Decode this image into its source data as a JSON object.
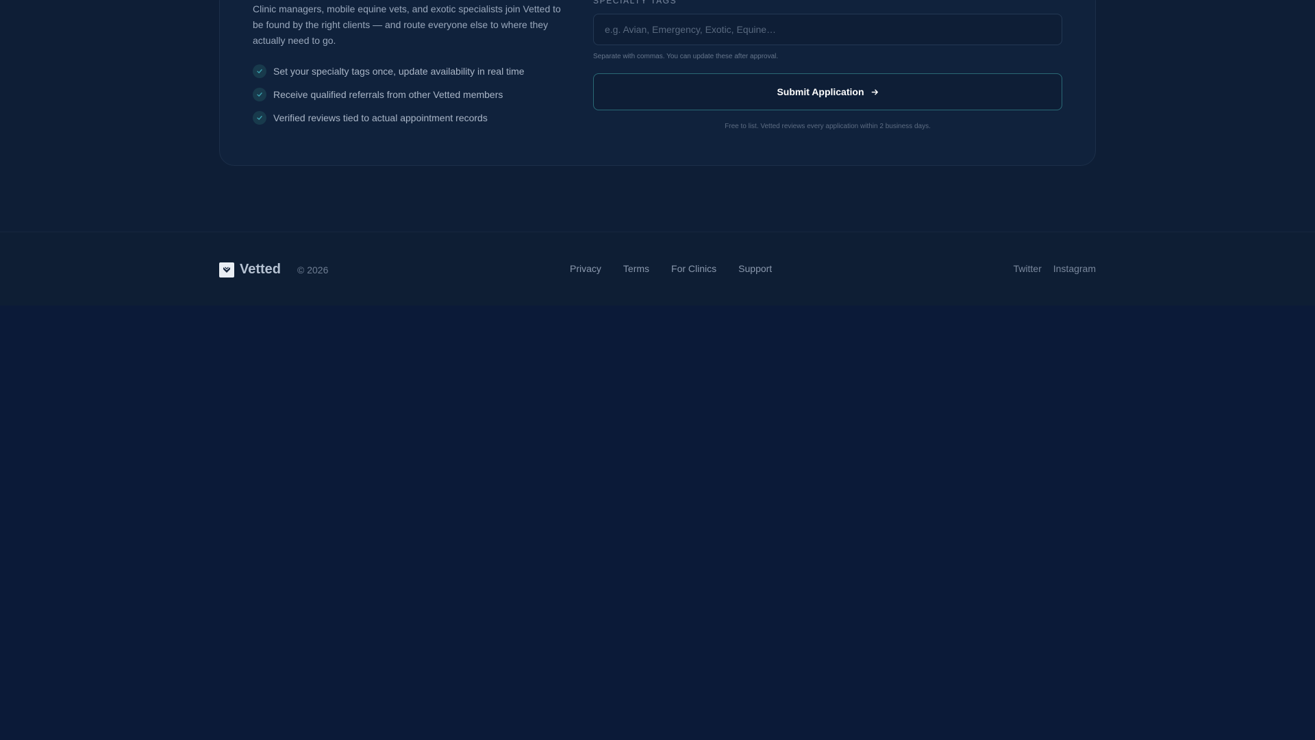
{
  "card": {
    "intro": "Clinic managers, mobile equine vets, and exotic specialists join Vetted to be found by the right clients — and route everyone else to where they actually need to go.",
    "benefits": [
      {
        "icon": "check-icon",
        "text": "Set your specialty tags once, update availability in real time"
      },
      {
        "icon": "check-icon",
        "text": "Receive qualified referrals from other Vetted members"
      },
      {
        "icon": "check-icon",
        "text": "Verified reviews tied to actual appointment records"
      }
    ],
    "form": {
      "specialty_label": "SPECIALTY TAGS",
      "specialty_placeholder": "e.g. Avian, Emergency, Exotic, Equine…",
      "specialty_value": "",
      "hint": "Separate with commas. You can update these after approval.",
      "submit_label": "Submit Application",
      "submit_icon": "arrow-right-icon",
      "fineprint": "Free to list. Vetted reviews every application within 2 business days."
    }
  },
  "footer": {
    "brand": "Vetted",
    "logo_icon": "vetted-logo-icon",
    "copyright": "© 2026",
    "links": [
      "Privacy",
      "Terms",
      "For Clinics",
      "Support"
    ],
    "social": [
      "Twitter",
      "Instagram"
    ]
  },
  "colors": {
    "background": "#0b1a38",
    "card": "#10223c",
    "accent_border": "#2a6a76",
    "check_bg": "#183a4c",
    "check_mark": "#3fa9b7"
  }
}
